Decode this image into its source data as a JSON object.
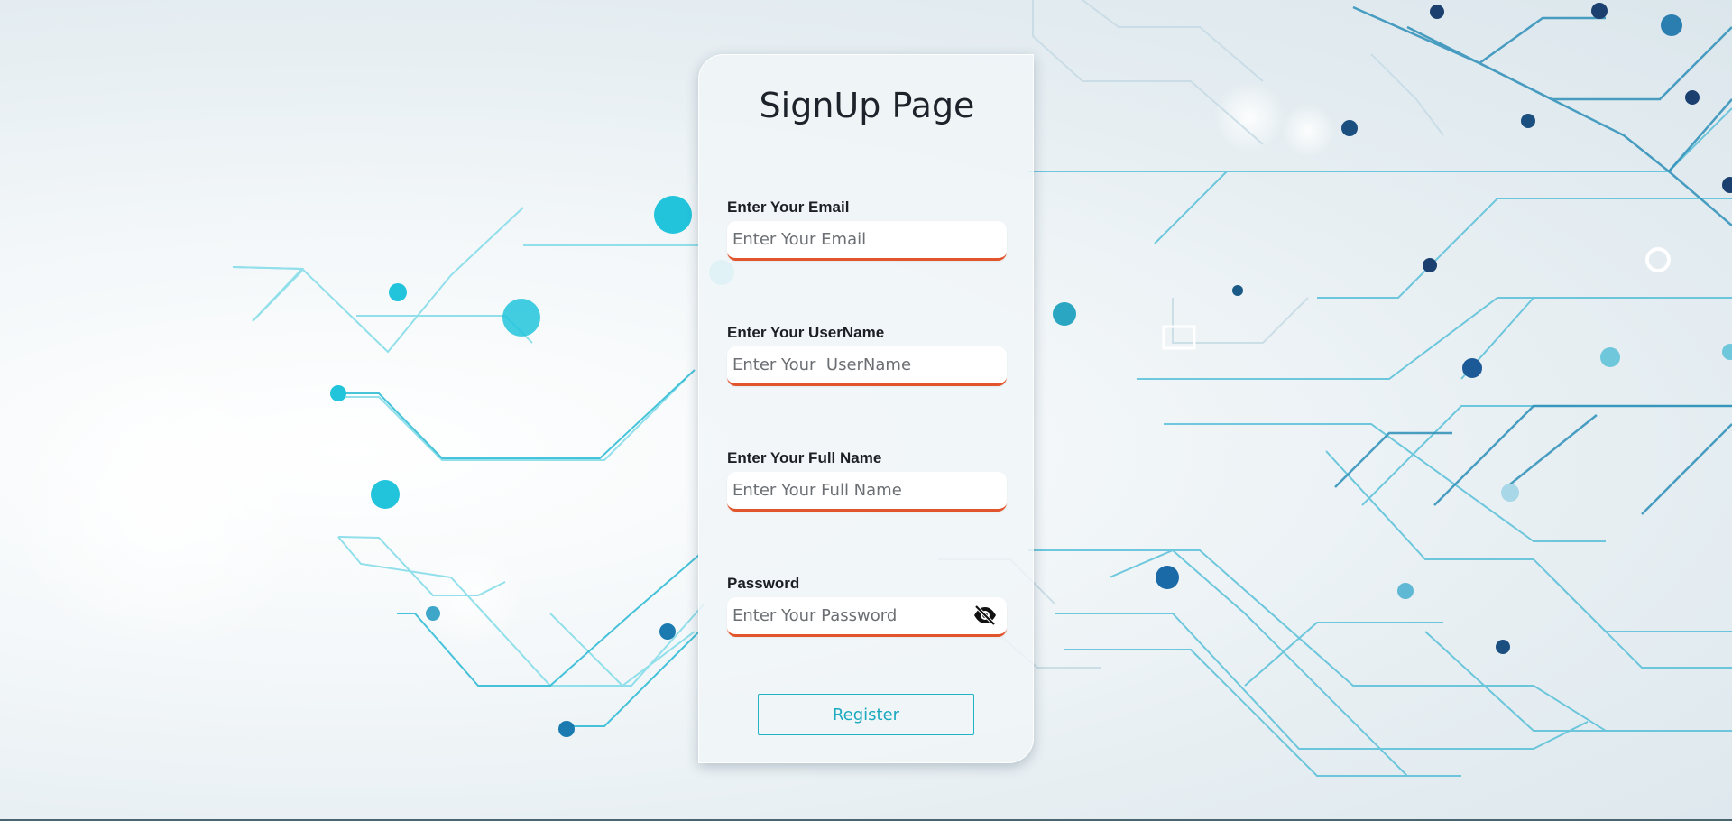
{
  "page_title": "SignUp Page",
  "fields": [
    {
      "label": "Enter Your Email",
      "placeholder": "Enter Your Email",
      "value": ""
    },
    {
      "label": "Enter Your UserName",
      "placeholder": "Enter Your  UserName",
      "value": ""
    },
    {
      "label": "Enter Your Full Name",
      "placeholder": "Enter Your Full Name",
      "value": ""
    },
    {
      "label": "Password",
      "placeholder": "Enter Your Password",
      "value": ""
    }
  ],
  "password_toggle_icon": "eye-off-icon",
  "register_label": "Register",
  "colors": {
    "accent_underline": "#e2542b",
    "button_accent": "#1fb3c7",
    "circuit_light": "#6fd3e3",
    "circuit_dark": "#1b5a86"
  }
}
